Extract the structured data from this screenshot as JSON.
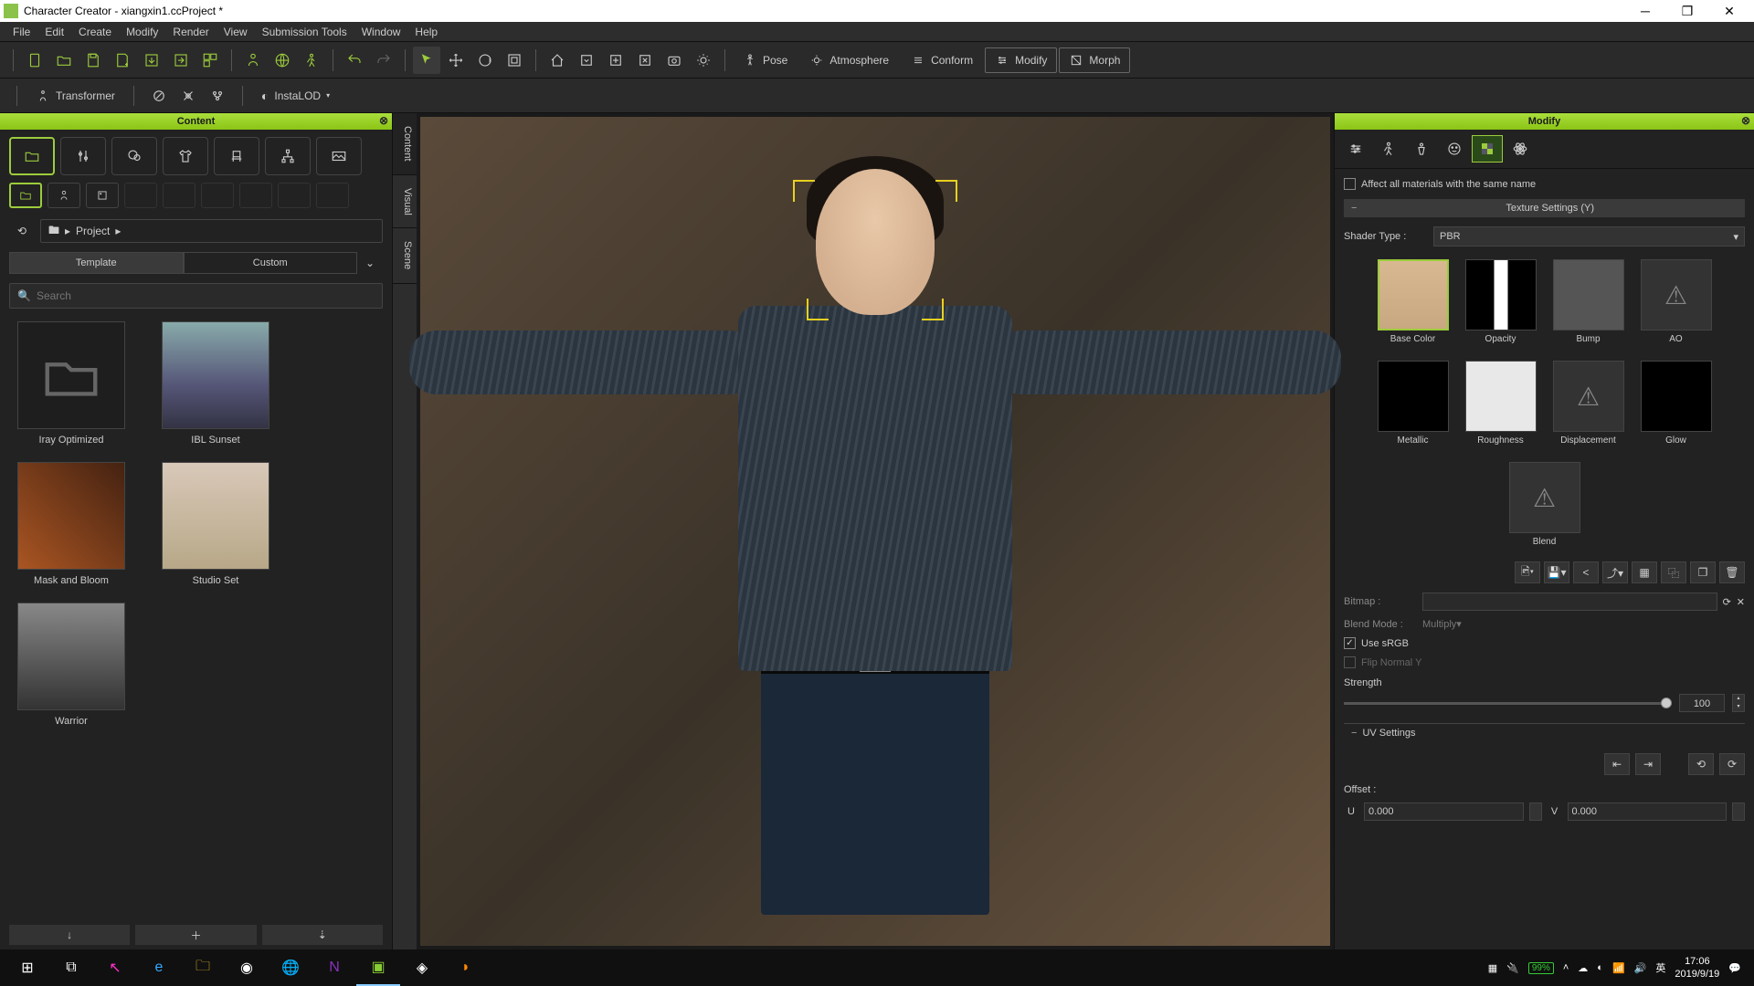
{
  "title": "Character Creator - xiangxin1.ccProject *",
  "menu": [
    "File",
    "Edit",
    "Create",
    "Modify",
    "Render",
    "View",
    "Submission Tools",
    "Window",
    "Help"
  ],
  "toolbar_text": {
    "pose": "Pose",
    "atmosphere": "Atmosphere",
    "conform": "Conform",
    "modify": "Modify",
    "morph": "Morph"
  },
  "toolbar2": {
    "transformer": "Transformer",
    "instalod": "InstaLOD"
  },
  "leftpanel": {
    "title": "Content",
    "breadcrumb": "Project",
    "tabs": {
      "template": "Template",
      "custom": "Custom"
    },
    "search_ph": "Search",
    "items": [
      {
        "label": "Iray Optimized",
        "type": "folder"
      },
      {
        "label": "IBL Sunset",
        "type": "img"
      },
      {
        "label": "Mask and Bloom",
        "type": "img"
      },
      {
        "label": "Studio Set",
        "type": "img"
      },
      {
        "label": "Warrior",
        "type": "img"
      }
    ]
  },
  "sidetabs": [
    "Content",
    "Visual",
    "Scene"
  ],
  "rightpanel": {
    "title": "Modify",
    "affect_all": "Affect all materials with the same name",
    "section": "Texture Settings  (Y)",
    "shader_label": "Shader Type :",
    "shader_value": "PBR",
    "textures": [
      "Base Color",
      "Opacity",
      "Bump",
      "AO",
      "Metallic",
      "Roughness",
      "Displacement",
      "Glow",
      "Blend"
    ],
    "bitmap": "Bitmap :",
    "blendmode_l": "Blend Mode :",
    "blendmode_v": "Multiply",
    "use_srgb": "Use sRGB",
    "flip": "Flip Normal Y",
    "strength": "Strength",
    "strength_v": "100",
    "uv": "UV Settings",
    "offset": "Offset :",
    "u": "U",
    "u_v": "0.000",
    "v": "V",
    "v_v": "0.000"
  },
  "taskbar": {
    "battery": "99%",
    "time": "17:06",
    "date": "2019/9/19"
  }
}
